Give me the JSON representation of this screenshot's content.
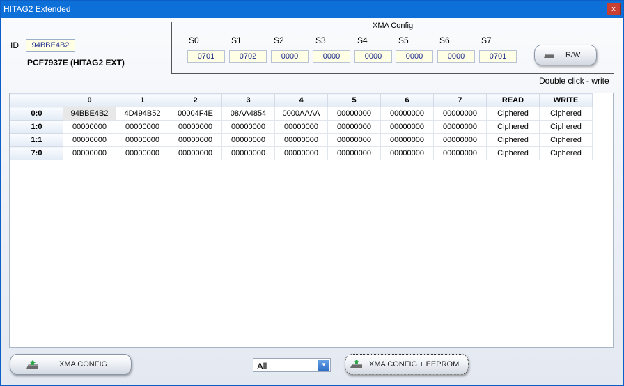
{
  "window": {
    "title": "HITAG2 Extended",
    "close_glyph": "x"
  },
  "tag": {
    "id_label": "ID",
    "id_value": "94BBE4B2",
    "chip_type": "PCF7937E (HITAG2 EXT)"
  },
  "xma": {
    "legend": "XMA Config",
    "slots": [
      {
        "label": "S0",
        "value": "0701"
      },
      {
        "label": "S1",
        "value": "0702"
      },
      {
        "label": "S2",
        "value": "0000"
      },
      {
        "label": "S3",
        "value": "0000"
      },
      {
        "label": "S4",
        "value": "0000"
      },
      {
        "label": "S5",
        "value": "0000"
      },
      {
        "label": "S6",
        "value": "0000"
      },
      {
        "label": "S7",
        "value": "0701"
      }
    ],
    "rw_label": "R/W",
    "hint": "Double click - write"
  },
  "grid": {
    "headers": [
      "",
      "0",
      "1",
      "2",
      "3",
      "4",
      "5",
      "6",
      "7",
      "READ",
      "WRITE"
    ],
    "rows": [
      {
        "label": "0:0",
        "cells": [
          "94BBE4B2",
          "4D494B52",
          "00004F4E",
          "08AA4854",
          "0000AAAA",
          "00000000",
          "00000000",
          "00000000"
        ],
        "read": "Ciphered",
        "write": "Ciphered"
      },
      {
        "label": "1:0",
        "cells": [
          "00000000",
          "00000000",
          "00000000",
          "00000000",
          "00000000",
          "00000000",
          "00000000",
          "00000000"
        ],
        "read": "Ciphered",
        "write": "Ciphered"
      },
      {
        "label": "1:1",
        "cells": [
          "00000000",
          "00000000",
          "00000000",
          "00000000",
          "00000000",
          "00000000",
          "00000000",
          "00000000"
        ],
        "read": "Ciphered",
        "write": "Ciphered"
      },
      {
        "label": "7:0",
        "cells": [
          "00000000",
          "00000000",
          "00000000",
          "00000000",
          "00000000",
          "00000000",
          "00000000",
          "00000000"
        ],
        "read": "Ciphered",
        "write": "Ciphered"
      }
    ]
  },
  "footer": {
    "xma_config_label": "XMA CONFIG",
    "filter_value": "All",
    "xma_eeprom_label": "XMA CONFIG + EEPROM"
  },
  "icons": {
    "button_icon": "chip-icon",
    "dropdown_icon": "chevron-down-icon"
  },
  "colors": {
    "titlebar": "#0d6fd8",
    "input_bg": "#ffffe6",
    "input_text": "#1a2a8a",
    "close": "#c84031"
  }
}
